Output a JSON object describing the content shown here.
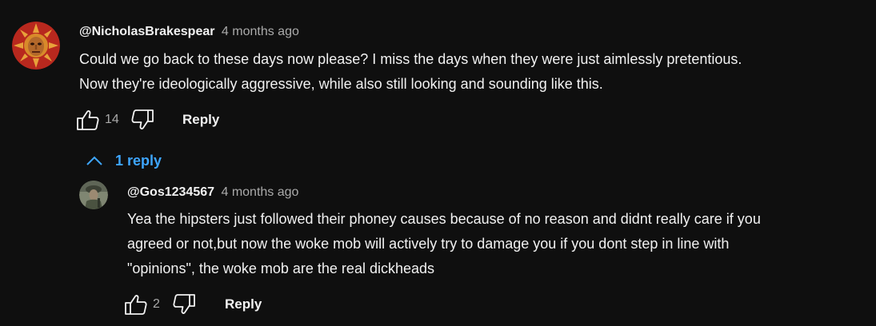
{
  "comments": [
    {
      "author": "@NicholasBrakespear",
      "time": "4 months ago",
      "text": "Could we go back to these days now please? I miss the days when they were just aimlessly pretentious.\nNow they're ideologically aggressive, while also still looking and sounding like this.",
      "likes": "14",
      "reply_label": "Reply",
      "avatar_icon": "sun-mask-avatar"
    }
  ],
  "replies_toggle": {
    "label": "1 reply",
    "icon": "chevron-up-icon",
    "color": "#3ea6ff"
  },
  "replies": [
    {
      "author": "@Gos1234567",
      "time": "4 months ago",
      "text": "Yea the hipsters just followed their phoney causes because of no reason and didnt really care if you\nagreed or not,but now the woke mob will actively try to damage you if you dont step in line with\n\"opinions\", the woke mob are the real dickheads",
      "likes": "2",
      "reply_label": "Reply",
      "avatar_icon": "soldier-avatar"
    }
  ]
}
